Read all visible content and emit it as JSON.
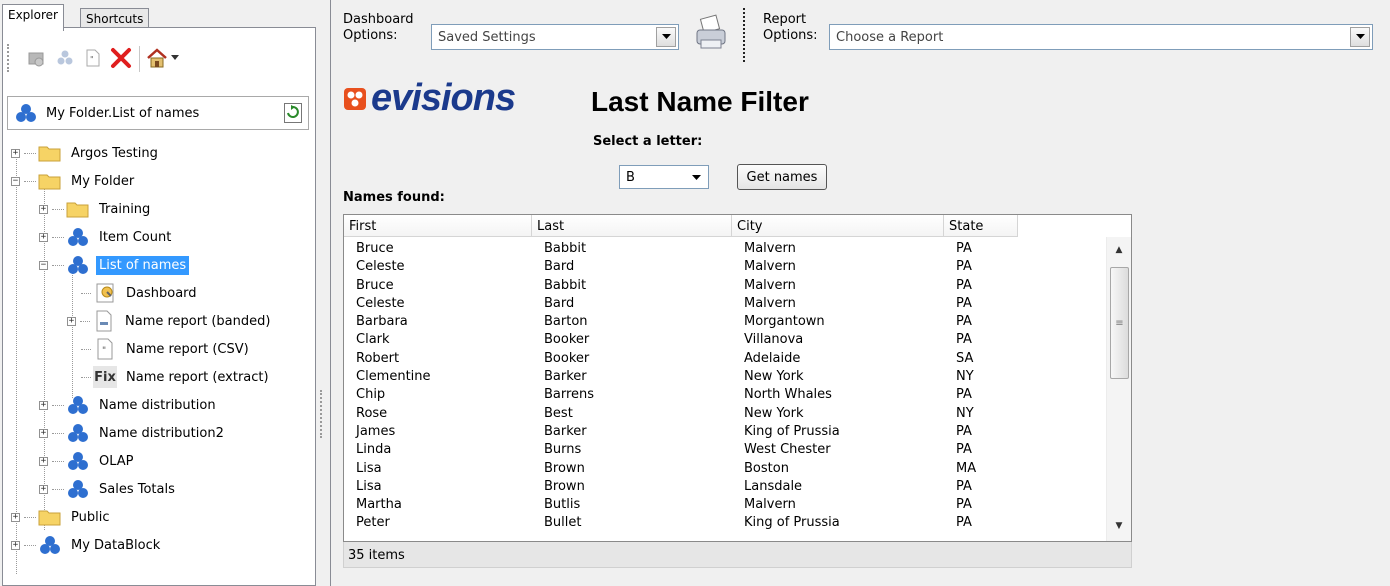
{
  "tabs": [
    {
      "label": "Explorer"
    },
    {
      "label": "Shortcuts"
    }
  ],
  "explorer": {
    "path": "My Folder.List of names",
    "tree": [
      {
        "label": "Argos Testing"
      },
      {
        "label": "My Folder"
      },
      {
        "label": "Training"
      },
      {
        "label": "Item Count"
      },
      {
        "label": "List of names"
      },
      {
        "label": "Dashboard"
      },
      {
        "label": "Name report (banded)"
      },
      {
        "label": "Name report (CSV)"
      },
      {
        "label": "Name report (extract)"
      },
      {
        "label": "Name distribution"
      },
      {
        "label": "Name distribution2"
      },
      {
        "label": "OLAP"
      },
      {
        "label": "Sales Totals"
      },
      {
        "label": "Public"
      },
      {
        "label": "My DataBlock"
      }
    ],
    "fix_glyph": "Fix"
  },
  "options": {
    "dashboard_label": "Dashboard\nOptions:",
    "dashboard_label_line1": "Dashboard",
    "dashboard_label_line2": "Options:",
    "dashboard_value": "Saved Settings",
    "report_label_line1": "Report",
    "report_label_line2": "Options:",
    "report_value": "Choose a Report"
  },
  "dashboard": {
    "logo_text": "evisions",
    "title": "Last Name Filter",
    "select_letter_label": "Select a letter:",
    "letter_value": "B",
    "get_names_label": "Get names",
    "names_found_label": "Names found:",
    "columns": [
      "First",
      "Last",
      "City",
      "State"
    ],
    "rows": [
      [
        "Bruce",
        "Babbit",
        "Malvern",
        "PA"
      ],
      [
        "Celeste",
        "Bard",
        "Malvern",
        "PA"
      ],
      [
        "Bruce",
        "Babbit",
        "Malvern",
        "PA"
      ],
      [
        "Celeste",
        "Bard",
        "Malvern",
        "PA"
      ],
      [
        "Barbara",
        "Barton",
        "Morgantown",
        "PA"
      ],
      [
        "Clark",
        "Booker",
        "Villanova",
        "PA"
      ],
      [
        "Robert",
        "Booker",
        "Adelaide",
        "SA"
      ],
      [
        "Clementine",
        "Barker",
        "New York",
        "NY"
      ],
      [
        "Chip",
        "Barrens",
        "North Whales",
        "PA"
      ],
      [
        "Rose",
        "Best",
        "New York",
        "NY"
      ],
      [
        "James",
        "Barker",
        "King of Prussia",
        "PA"
      ],
      [
        "Linda",
        "Burns",
        "West Chester",
        "PA"
      ],
      [
        "Lisa",
        "Brown",
        "Boston",
        "MA"
      ],
      [
        "Lisa",
        "Brown",
        "Lansdale",
        "PA"
      ],
      [
        "Martha",
        "Butlis",
        "Malvern",
        "PA"
      ],
      [
        "Peter",
        "Bullet",
        "King of Prussia",
        "PA"
      ]
    ],
    "status": "35 items"
  },
  "colors": {
    "selection": "#3399ff",
    "logo_blue": "#1b3a8c",
    "logo_orange": "#e8501e",
    "folder_yellow": "#f6d365"
  }
}
